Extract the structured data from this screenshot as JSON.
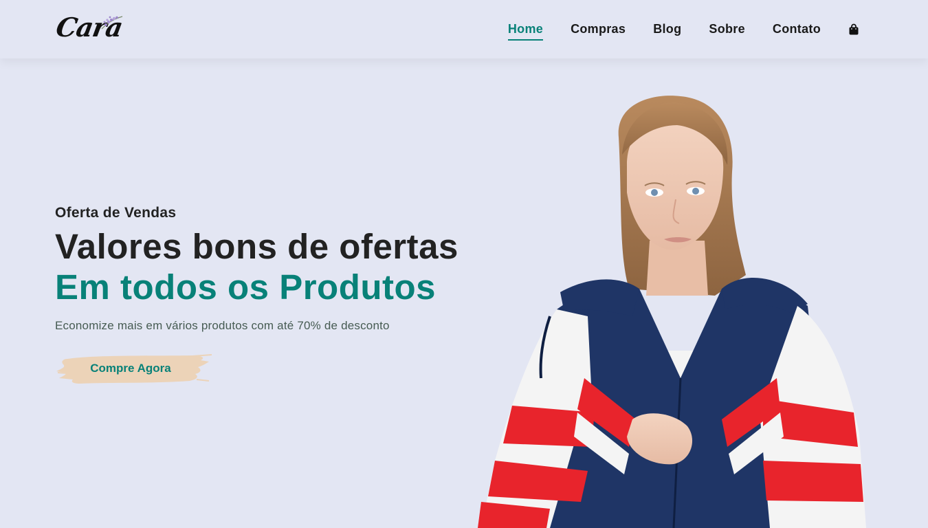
{
  "brand": {
    "logo_text": "Cara"
  },
  "nav": {
    "items": [
      {
        "label": "Home",
        "active": true
      },
      {
        "label": "Compras",
        "active": false
      },
      {
        "label": "Blog",
        "active": false
      },
      {
        "label": "Sobre",
        "active": false
      },
      {
        "label": "Contato",
        "active": false
      }
    ],
    "cart_icon": "shopping-bag-icon"
  },
  "hero": {
    "eyebrow": "Oferta de Vendas",
    "title_line_1": "Valores bons de ofertas",
    "title_line_2": "Em todos os Produtos",
    "subtitle": "Economize mais em vários produtos com até 70% de desconto",
    "cta_label": "Compre Agora",
    "image": "model-in-track-jacket"
  },
  "colors": {
    "background": "#e3e6f3",
    "accent": "#088178",
    "text_dark": "#222222",
    "cta_brush": "#ecd3b8"
  }
}
